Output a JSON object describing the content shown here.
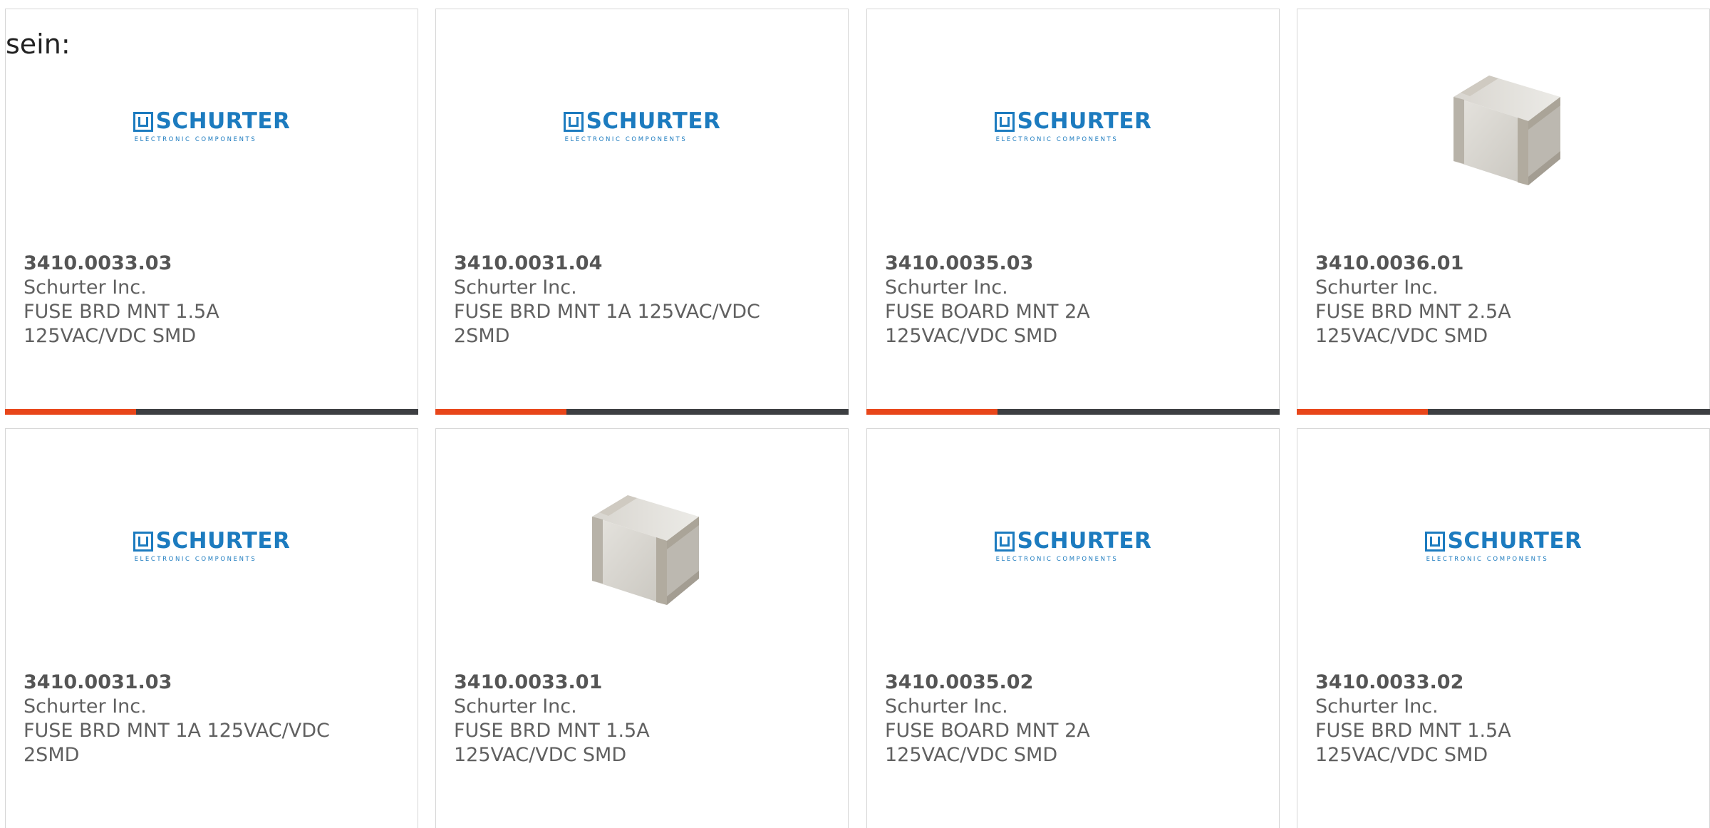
{
  "intro_text": "sein:",
  "colors": {
    "logo_blue": "#1c7bbf",
    "bar_dark": "#3d3f42",
    "bar_accent": "#e8461a",
    "text_gray": "#606060"
  },
  "logo": {
    "word": "SCHURTER",
    "tagline": "ELECTRONIC COMPONENTS"
  },
  "products": [
    {
      "part_number": "3410.0033.03",
      "manufacturer": "Schurter Inc.",
      "desc_line1": "FUSE BRD MNT 1.5A",
      "desc_line2": "125VAC/VDC SMD",
      "image": "schurter-logo"
    },
    {
      "part_number": "3410.0031.04",
      "manufacturer": "Schurter Inc.",
      "desc_line1": "FUSE BRD MNT 1A 125VAC/VDC",
      "desc_line2": "2SMD",
      "image": "schurter-logo"
    },
    {
      "part_number": "3410.0035.03",
      "manufacturer": "Schurter Inc.",
      "desc_line1": "FUSE BOARD MNT 2A",
      "desc_line2": "125VAC/VDC SMD",
      "image": "schurter-logo"
    },
    {
      "part_number": "3410.0036.01",
      "manufacturer": "Schurter Inc.",
      "desc_line1": "FUSE BRD MNT 2.5A",
      "desc_line2": "125VAC/VDC SMD",
      "image": "fuse-photo"
    },
    {
      "part_number": "3410.0031.03",
      "manufacturer": "Schurter Inc.",
      "desc_line1": "FUSE BRD MNT 1A 125VAC/VDC",
      "desc_line2": "2SMD",
      "image": "schurter-logo"
    },
    {
      "part_number": "3410.0033.01",
      "manufacturer": "Schurter Inc.",
      "desc_line1": "FUSE BRD MNT 1.5A",
      "desc_line2": "125VAC/VDC SMD",
      "image": "fuse-photo"
    },
    {
      "part_number": "3410.0035.02",
      "manufacturer": "Schurter Inc.",
      "desc_line1": "FUSE BOARD MNT 2A",
      "desc_line2": "125VAC/VDC SMD",
      "image": "schurter-logo"
    },
    {
      "part_number": "3410.0033.02",
      "manufacturer": "Schurter Inc.",
      "desc_line1": "FUSE BRD MNT 1.5A",
      "desc_line2": "125VAC/VDC SMD",
      "image": "schurter-logo"
    }
  ]
}
